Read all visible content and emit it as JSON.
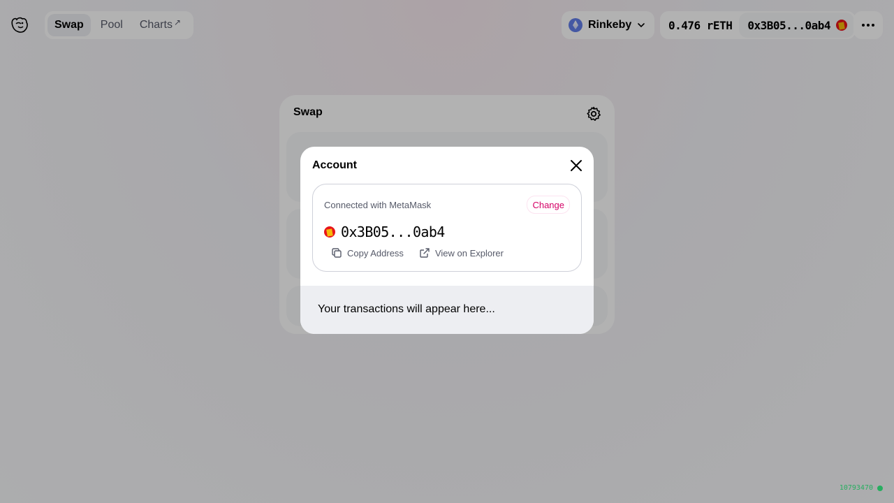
{
  "nav": {
    "items": [
      {
        "label": "Swap",
        "active": true
      },
      {
        "label": "Pool",
        "active": false
      },
      {
        "label": "Charts",
        "external": true
      }
    ]
  },
  "network": {
    "label": "Rinkeby",
    "icon": "ethereum-icon"
  },
  "wallet": {
    "balance": "0.476 rETH",
    "address": "0x3B05...0ab4"
  },
  "swap": {
    "title": "Swap"
  },
  "modal": {
    "title": "Account",
    "connected_text": "Connected with MetaMask",
    "change_label": "Change",
    "address": "0x3B05...0ab4",
    "copy_label": "Copy Address",
    "explorer_label": "View on Explorer",
    "transactions_empty": "Your transactions will appear here..."
  },
  "footer": {
    "block_number": "10793470"
  },
  "colors": {
    "accent": "#d50066",
    "network": "#627eea",
    "status": "#27ae60"
  }
}
